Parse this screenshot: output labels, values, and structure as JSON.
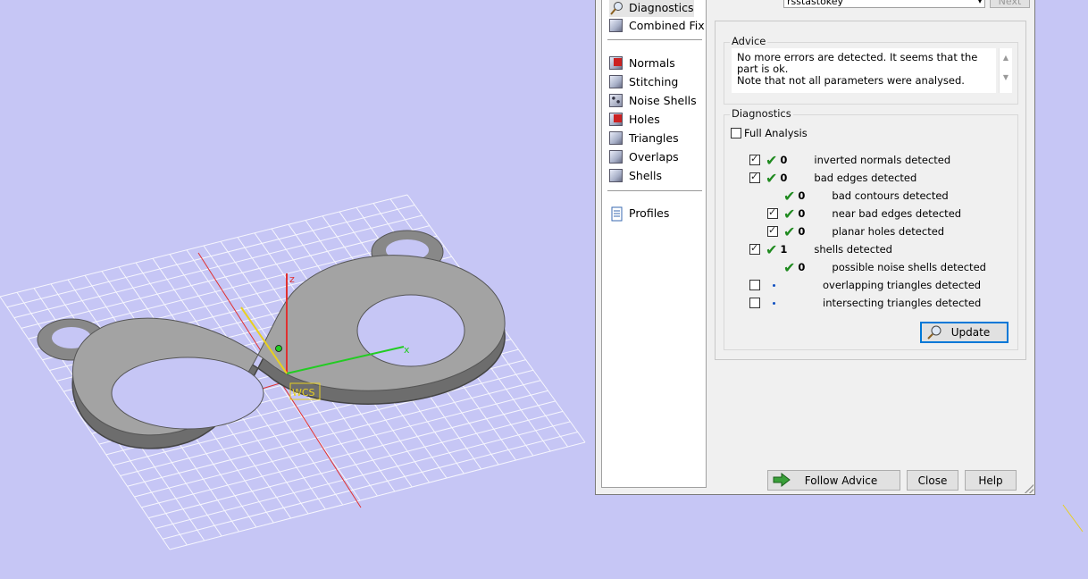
{
  "viewport": {
    "axis_x": "x",
    "axis_z": "z",
    "wcs_label": "WCS"
  },
  "nav": {
    "items_top": [
      {
        "label": "Diagnostics",
        "icon": "magnifier-icon"
      },
      {
        "label": "Combined Fix",
        "icon": "cube-icon"
      }
    ],
    "items_mid": [
      {
        "label": "Normals",
        "icon": "normals-cube-icon"
      },
      {
        "label": "Stitching",
        "icon": "stitching-cube-icon"
      },
      {
        "label": "Noise Shells",
        "icon": "noise-shells-cube-icon"
      },
      {
        "label": "Holes",
        "icon": "holes-cube-icon"
      },
      {
        "label": "Triangles",
        "icon": "triangles-cube-icon"
      },
      {
        "label": "Overlaps",
        "icon": "overlaps-cube-icon"
      },
      {
        "label": "Shells",
        "icon": "shells-cube-icon"
      }
    ],
    "items_bottom": [
      {
        "label": "Profiles",
        "icon": "document-icon"
      }
    ]
  },
  "top": {
    "dropdown_value": "rsstastokey",
    "next_label": "Next"
  },
  "advice": {
    "title": "Advice",
    "line1": "No more errors are detected. It seems that the part is ok.",
    "line2": "Note that not all parameters were analysed."
  },
  "diagnostics": {
    "title": "Diagnostics",
    "full_analysis_label": "Full Analysis",
    "rows": [
      {
        "count": "0",
        "label": "inverted normals detected"
      },
      {
        "count": "0",
        "label": "bad edges detected"
      },
      {
        "count": "0",
        "label": "bad contours detected"
      },
      {
        "count": "0",
        "label": "near bad edges detected"
      },
      {
        "count": "0",
        "label": "planar holes detected"
      },
      {
        "count": "1",
        "label": "shells detected"
      },
      {
        "count": "0",
        "label": "possible noise shells detected"
      },
      {
        "count": "",
        "label": "overlapping triangles detected"
      },
      {
        "count": "",
        "label": "intersecting triangles detected"
      }
    ],
    "update_label": "Update"
  },
  "buttons": {
    "follow_advice": "Follow Advice",
    "close": "Close",
    "help": "Help"
  },
  "colors": {
    "background": "#c6c6f5",
    "check_green": "#1f8a1f",
    "accent": "#0078d7"
  }
}
